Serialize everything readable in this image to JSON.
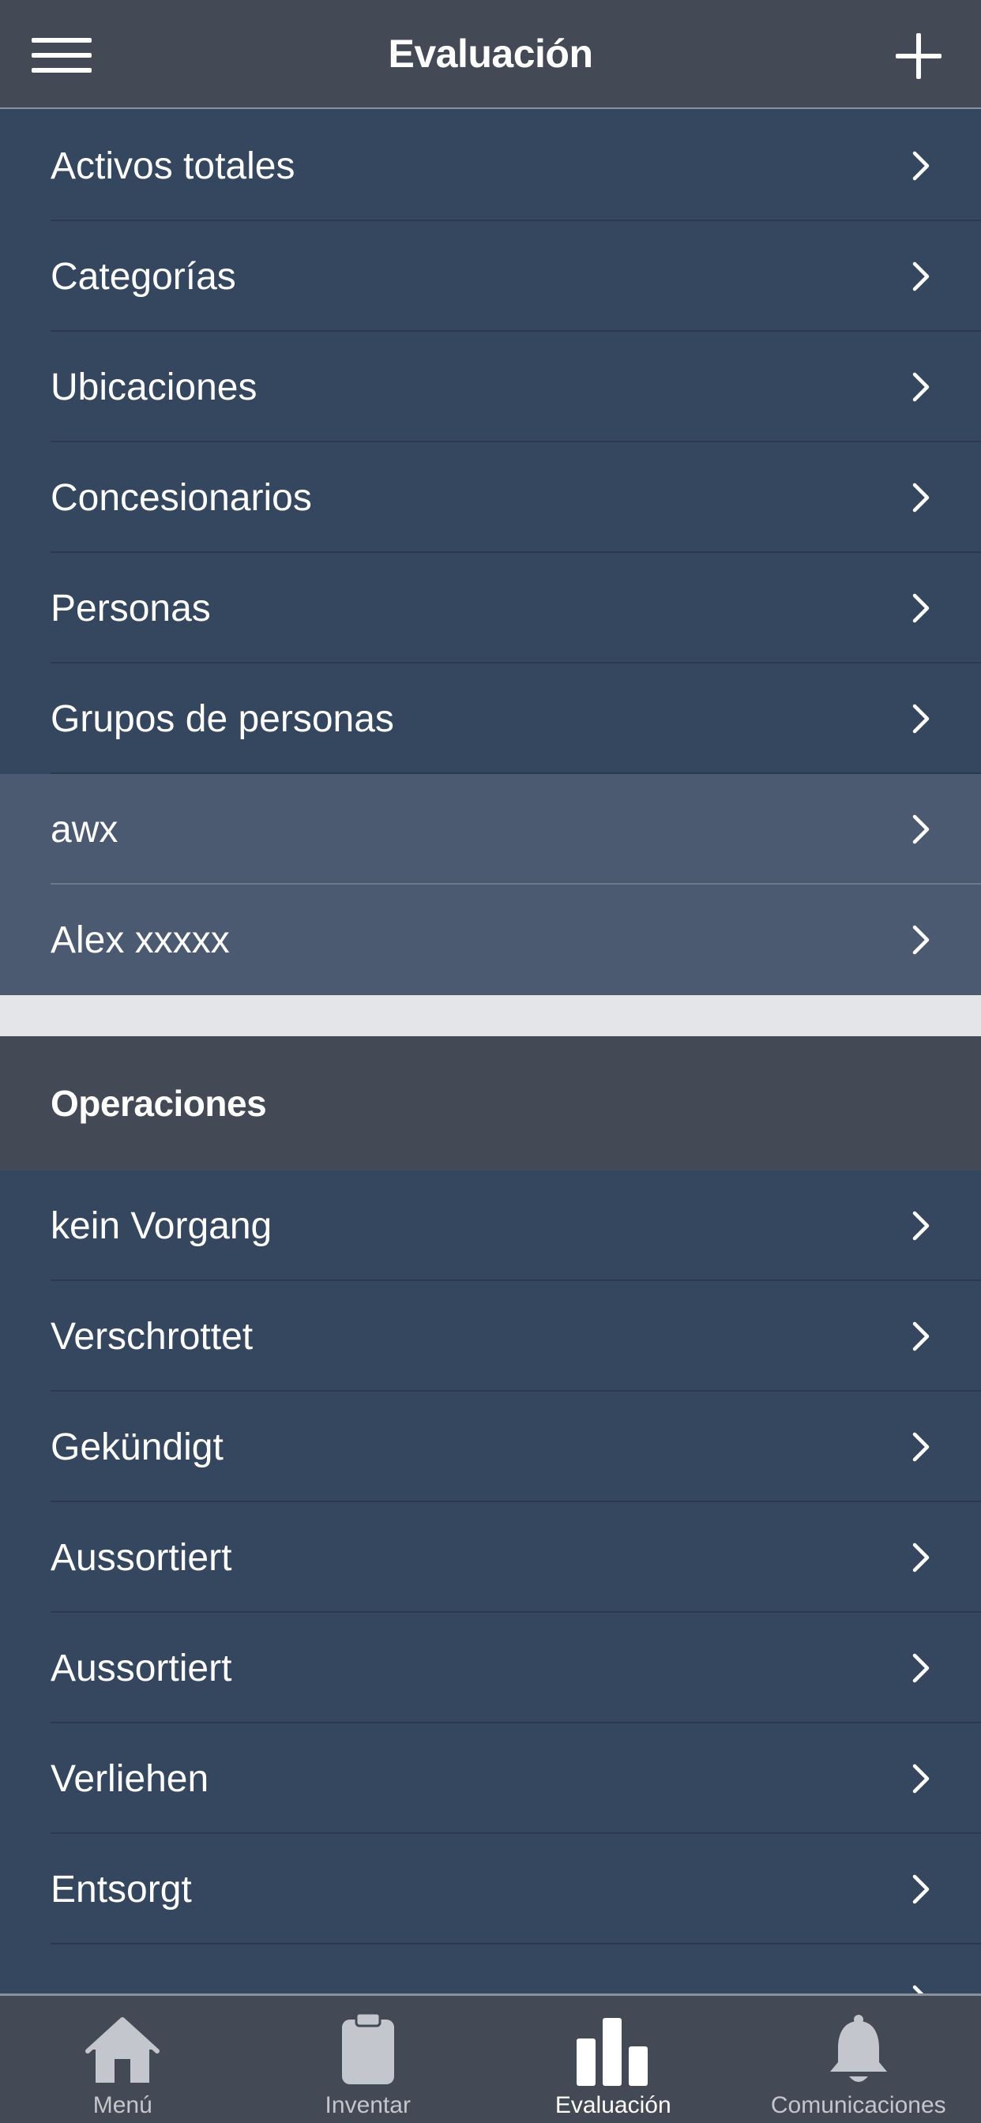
{
  "header": {
    "title": "Evaluación"
  },
  "list_top": [
    {
      "label": "Activos totales",
      "style": "dark"
    },
    {
      "label": "Categorías",
      "style": "dark"
    },
    {
      "label": "Ubicaciones",
      "style": "dark"
    },
    {
      "label": "Concesionarios",
      "style": "dark"
    },
    {
      "label": "Personas",
      "style": "dark"
    },
    {
      "label": "Grupos de personas",
      "style": "dark"
    },
    {
      "label": "awx",
      "style": "light"
    },
    {
      "label": "Alex xxxxx",
      "style": "light"
    }
  ],
  "section": {
    "title": "Operaciones"
  },
  "list_operations": [
    {
      "label": "kein Vorgang"
    },
    {
      "label": "Verschrottet"
    },
    {
      "label": "Gekündigt"
    },
    {
      "label": "Aussortiert"
    },
    {
      "label": "Aussortiert"
    },
    {
      "label": "Verliehen"
    },
    {
      "label": "Entsorgt"
    }
  ],
  "tabbar": {
    "tabs": [
      {
        "label": "Menú",
        "icon": "home-icon",
        "active": false
      },
      {
        "label": "Inventar",
        "icon": "clipboard-icon",
        "active": false
      },
      {
        "label": "Evaluación",
        "icon": "bar-chart-icon",
        "active": true
      },
      {
        "label": "Comunicaciones",
        "icon": "bell-icon",
        "active": false
      }
    ]
  },
  "colors": {
    "header_bg": "#434955",
    "list_bg": "#35465f",
    "list_highlight_bg": "#4b5a71",
    "separator_bg": "#e4e5e9",
    "tab_inactive_icon": "#c3c6cc",
    "tab_active_icon": "#ffffff"
  }
}
